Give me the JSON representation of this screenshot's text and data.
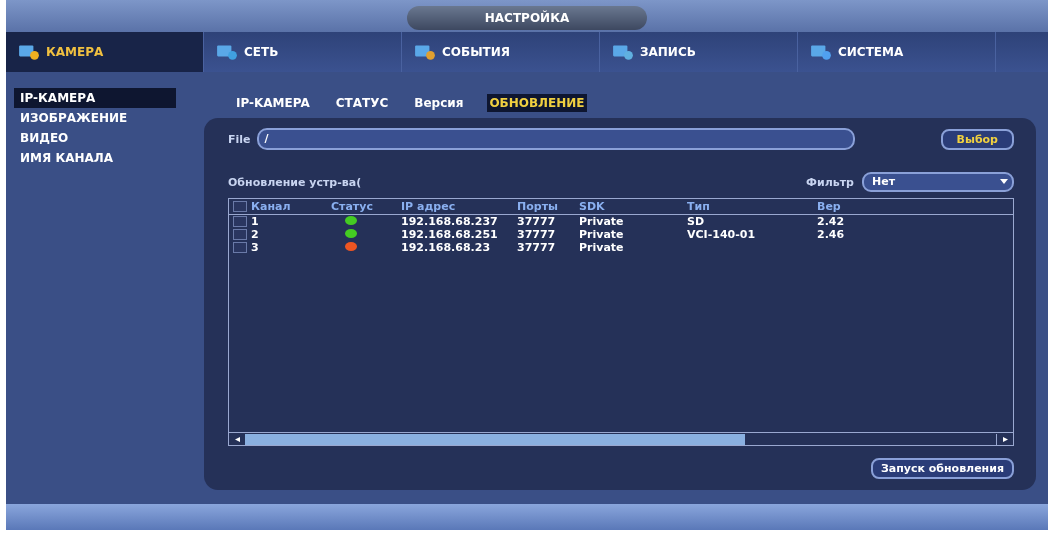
{
  "window": {
    "title": "НАСТРОЙКА"
  },
  "main_tabs": [
    {
      "label": "КАМЕРА",
      "selected": true,
      "kind": "camera"
    },
    {
      "label": "СЕТЬ",
      "selected": false,
      "kind": "network"
    },
    {
      "label": "СОБЫТИЯ",
      "selected": false,
      "kind": "events"
    },
    {
      "label": "ЗАПИСЬ",
      "selected": false,
      "kind": "record"
    },
    {
      "label": "СИСТЕМА",
      "selected": false,
      "kind": "system"
    }
  ],
  "sidebar": {
    "items": [
      {
        "label": "IP-КАМЕРА",
        "selected": true
      },
      {
        "label": "ИЗОБРАЖЕНИЕ",
        "selected": false
      },
      {
        "label": "ВИДЕО",
        "selected": false
      },
      {
        "label": "ИМЯ КАНАЛА",
        "selected": false
      }
    ]
  },
  "sub_tabs": [
    {
      "label": "IP-KAMEPA",
      "selected": false
    },
    {
      "label": "СТАТУС",
      "selected": false
    },
    {
      "label": "Версия",
      "selected": false
    },
    {
      "label": "ОБНОВЛЕНИЕ",
      "selected": true
    }
  ],
  "file": {
    "label": "File",
    "value": "/"
  },
  "select_button": "Выбор",
  "section_title": "Обновление устр-ва(",
  "filter": {
    "label": "Фильтр",
    "value": "Нет"
  },
  "table": {
    "header_checked": false,
    "columns": [
      "Канал",
      "Статус",
      "IP адрес",
      "Порты",
      "SDK",
      "Тип",
      "Вер"
    ],
    "rows": [
      {
        "checked": false,
        "channel": "1",
        "color": "#44cc22",
        "ip": "192.168.68.237",
        "port": "37777",
        "sdk": "Private",
        "type": "SD",
        "version": "2.42"
      },
      {
        "checked": false,
        "channel": "2",
        "color": "#44cc22",
        "ip": "192.168.68.251",
        "port": "37777",
        "sdk": "Private",
        "type": "VCI-140-01",
        "version": "2.46"
      },
      {
        "checked": false,
        "channel": "3",
        "color": "#ee5522",
        "ip": "192.168.68.23",
        "port": "37777",
        "sdk": "Private"
      }
    ]
  },
  "start_button": "Запуск обновления"
}
